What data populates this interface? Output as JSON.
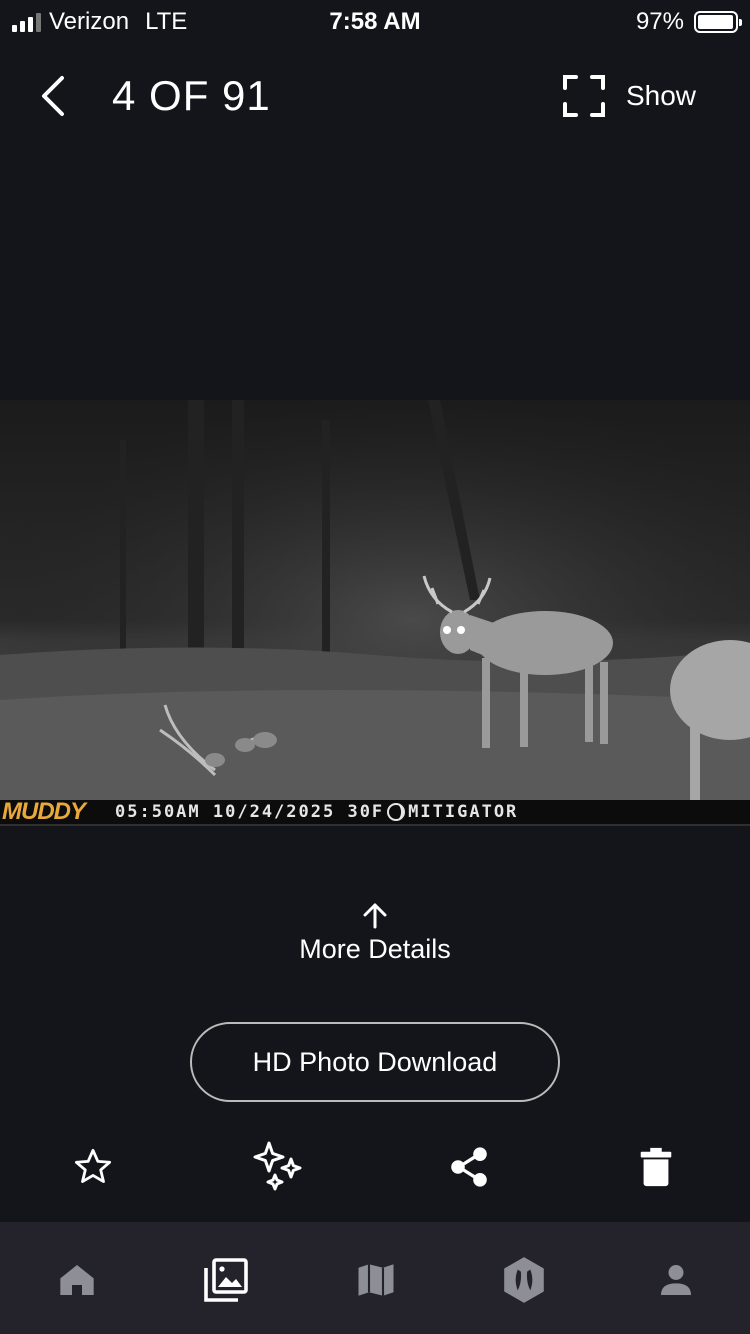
{
  "status": {
    "carrier": "Verizon",
    "network": "LTE",
    "time": "7:58 AM",
    "battery": "97%",
    "battery_level": 0.97
  },
  "header": {
    "counter": "4 OF 91",
    "show_label": "Show"
  },
  "photo": {
    "brand": "MUDDY",
    "camera_info": "05:50AM 10/24/2025 30F",
    "camera_name": "MITIGATOR"
  },
  "details": {
    "more_label": "More Details"
  },
  "download": {
    "label": "HD Photo Download"
  },
  "actions": [
    "star-icon",
    "sparkle-icon",
    "share-icon",
    "trash-icon"
  ],
  "nav": [
    "home-icon",
    "gallery-icon",
    "map-icon",
    "deer-track-icon",
    "profile-icon"
  ],
  "colors": {
    "background": "#14141b",
    "nav_background": "#24232b",
    "brand": "#e8a93a",
    "nav_icon": "#8e8e96"
  }
}
